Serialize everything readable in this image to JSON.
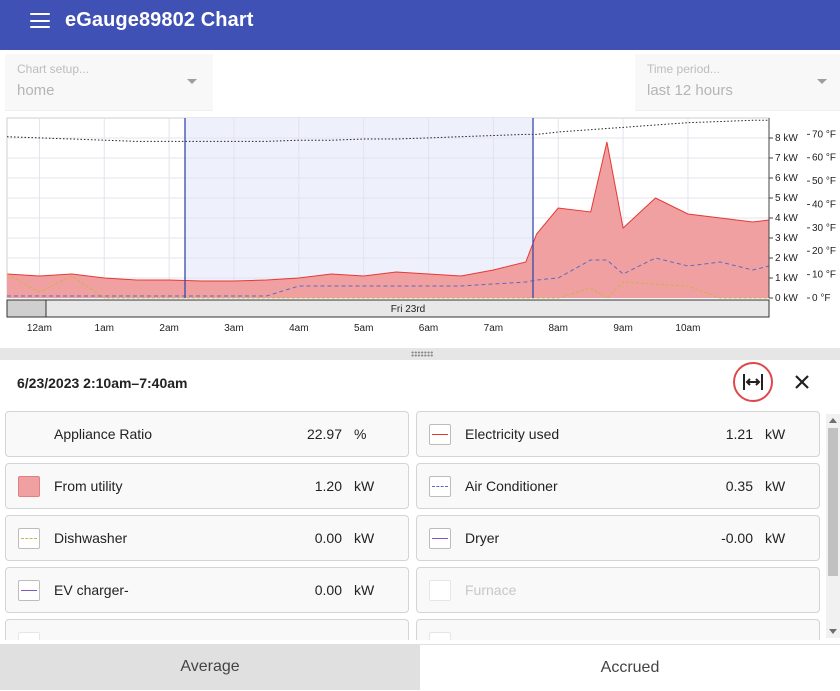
{
  "app": {
    "title": "eGauge89802 Chart",
    "menu_icon": "hamburger-menu-icon"
  },
  "controls": {
    "chart_setup": {
      "label": "Chart setup...",
      "value": "home"
    },
    "time_period": {
      "label": "Time period...",
      "value": "last 12 hours"
    }
  },
  "colors": {
    "appbar": "#3f51b5",
    "from_utility_fill": "#f0a0a0",
    "electricity_line": "#e53935",
    "air_conditioner_line": "#5c6bc0",
    "dishwasher_line": "#c9b44a",
    "selection_fill": "#eef0fc",
    "selection_line": "#3949ab",
    "highlight_ring": "#e0474c"
  },
  "chart": {
    "kw_ticks": [
      "0 kW",
      "1 kW",
      "2 kW",
      "3 kW",
      "4 kW",
      "5 kW",
      "6 kW",
      "7 kW",
      "8 kW"
    ],
    "temp_ticks": [
      "0 °F",
      "10 °F",
      "20 °F",
      "30 °F",
      "40 °F",
      "50 °F",
      "60 °F",
      "70 °F"
    ],
    "time_ticks": [
      "12am",
      "1am",
      "2am",
      "3am",
      "4am",
      "5am",
      "6am",
      "7am",
      "8am",
      "9am",
      "10am"
    ],
    "date_label": "Fri 23rd"
  },
  "chart_data": {
    "type": "area",
    "x_unit": "time of day, Fri 23rd",
    "y_left_unit": "kW",
    "y_right_unit": "°F",
    "ylim_left": [
      0,
      9
    ],
    "ylim_right": [
      0,
      77
    ],
    "selection": {
      "start": "2:10am",
      "end": "7:40am"
    },
    "x": [
      "11:30pm",
      "12am",
      "12:30am",
      "1am",
      "1:30am",
      "2am",
      "2:30am",
      "3am",
      "3:30am",
      "4am",
      "4:30am",
      "5am",
      "5:30am",
      "6am",
      "6:30am",
      "7am",
      "7:30am",
      "7:40am",
      "8am",
      "8:30am",
      "8:45am",
      "9am",
      "9:30am",
      "10am",
      "10:30am",
      "11am",
      "11:15am"
    ],
    "series": [
      {
        "name": "From utility",
        "values": [
          1.2,
          1.1,
          1.2,
          1.0,
          0.9,
          0.9,
          0.85,
          0.85,
          0.9,
          1.0,
          1.2,
          1.1,
          1.3,
          1.2,
          1.1,
          1.4,
          1.8,
          3.2,
          4.5,
          4.3,
          7.8,
          3.5,
          5.0,
          4.2,
          4.0,
          3.8,
          3.9
        ]
      },
      {
        "name": "Air Conditioner",
        "values": [
          0.1,
          0.1,
          0.1,
          0.1,
          0.1,
          0.1,
          0.1,
          0.1,
          0.1,
          0.6,
          0.6,
          0.6,
          0.6,
          0.6,
          0.6,
          0.7,
          0.8,
          0.9,
          1.0,
          1.9,
          1.9,
          1.2,
          2.0,
          1.6,
          1.8,
          1.4,
          1.6
        ]
      },
      {
        "name": "Dishwasher",
        "values": [
          1.2,
          0.3,
          1.1,
          0,
          0,
          0,
          0,
          0,
          0,
          0,
          0,
          0,
          0,
          0,
          0,
          0,
          0,
          0,
          0,
          0.5,
          0,
          0.8,
          0.7,
          0.6,
          0,
          0,
          0
        ]
      },
      {
        "name": "Temperature",
        "unit": "°F",
        "values": [
          69,
          68.5,
          68,
          67.5,
          67,
          67,
          67,
          67,
          67,
          67.5,
          67.5,
          68,
          68,
          68.5,
          69,
          69.5,
          70,
          70,
          71,
          72,
          72.5,
          73,
          74,
          75,
          75.5,
          76,
          76
        ]
      }
    ]
  },
  "summary": {
    "range": "6/23/2023 2:10am–7:40am",
    "fit_icon": "fit-width-icon",
    "close_icon": "close-icon"
  },
  "items": [
    {
      "name": "Appliance Ratio",
      "value": "22.97",
      "unit": "%",
      "swatch": "none"
    },
    {
      "name": "Electricity used",
      "value": "1.21",
      "unit": "kW",
      "swatch": "solid-red-line"
    },
    {
      "name": "From utility",
      "value": "1.20",
      "unit": "kW",
      "swatch": "filled-pink"
    },
    {
      "name": "Air Conditioner",
      "value": "0.35",
      "unit": "kW",
      "swatch": "dashed-blue-line"
    },
    {
      "name": "Dishwasher",
      "value": "0.00",
      "unit": "kW",
      "swatch": "dashed-yellow-line"
    },
    {
      "name": "Dryer",
      "value": "-0.00",
      "unit": "kW",
      "swatch": "solid-purple-line"
    },
    {
      "name": "EV charger-",
      "value": "0.00",
      "unit": "kW",
      "swatch": "solid-purple-line"
    },
    {
      "name": "Furnace",
      "value": "",
      "unit": "",
      "swatch": "empty"
    }
  ],
  "tabs": [
    {
      "label": "Average",
      "active": true
    },
    {
      "label": "Accrued",
      "active": false
    }
  ]
}
